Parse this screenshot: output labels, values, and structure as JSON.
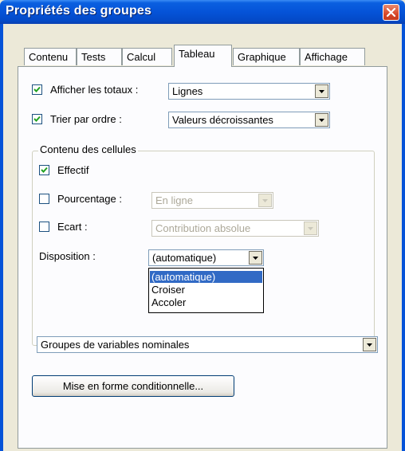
{
  "window": {
    "title": "Propriétés des groupes"
  },
  "tabs": [
    {
      "label": "Contenu",
      "active": false
    },
    {
      "label": "Tests",
      "active": false
    },
    {
      "label": "Calcul",
      "active": false
    },
    {
      "label": "Tableau",
      "active": true
    },
    {
      "label": "Graphique",
      "active": false
    },
    {
      "label": "Affichage",
      "active": false
    }
  ],
  "options": {
    "afficher_totaux": {
      "label": "Afficher les totaux :",
      "checked": true,
      "value": "Lignes"
    },
    "trier_ordre": {
      "label": "Trier par ordre :",
      "checked": true,
      "value": "Valeurs décroissantes"
    }
  },
  "cell_content": {
    "title": "Contenu des cellules",
    "effectif": {
      "label": "Effectif",
      "checked": true
    },
    "pourcentage": {
      "label": "Pourcentage :",
      "checked": false,
      "value": "En ligne",
      "enabled": false
    },
    "ecart": {
      "label": "Ecart :",
      "checked": false,
      "value": "Contribution absolue",
      "enabled": false
    },
    "disposition": {
      "label": "Disposition :",
      "value": "(automatique)",
      "open": true,
      "items": [
        "(automatique)",
        "Croiser",
        "Accoler"
      ],
      "selected_index": 0
    }
  },
  "groups_select": {
    "value": "Groupes de variables nominales"
  },
  "buttons": {
    "conditional_format": "Mise en forme conditionnelle..."
  }
}
